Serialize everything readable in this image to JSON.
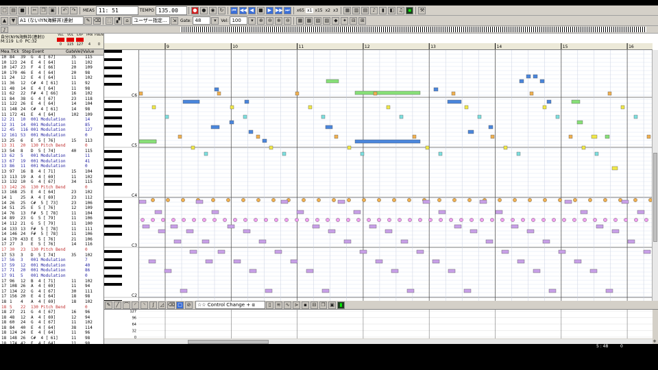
{
  "toolbar": {
    "meas_label": "MEAS",
    "position": "11:  51",
    "tempo_label": "TEMPO",
    "tempo": "135.00",
    "quant_buttons": [
      "x65",
      "x1",
      "x15",
      "x2",
      "x3"
    ],
    "track_select": "A1 (ないIYN海鮮丼)連射",
    "display_mode": "ユーザー指定...",
    "gate_label": "Gate:",
    "gate_value": "48",
    "vel_label": "Vel:",
    "vel_value": "100"
  },
  "track_info": {
    "name": "自分(NYN海鮮丼(連射))",
    "m_label": "M:",
    "m_value": "119",
    "l_label": "L:",
    "l_value": "0",
    "pc_label": "PC:",
    "pc_value": "32",
    "params": [
      "VEL",
      "VOL",
      "EXP",
      "PAN",
      "P.BEND",
      "MOD",
      "HOLD",
      "CUT",
      "RESO",
      "REV",
      "CHO",
      "DLY"
    ],
    "values": [
      "0",
      "115",
      "127",
      "4",
      "0",
      "0",
      "0",
      "0",
      "40",
      "0",
      "0",
      "0"
    ]
  },
  "event_header": {
    "mea": "Mea.",
    "tick": "Tick",
    "step": "Step",
    "event": "Event",
    "gate": "Gate",
    "vel": "Vel/Value"
  },
  "events": [
    [
      "10",
      "84",
      "39",
      "G  4 [ 67]",
      "35",
      "115"
    ],
    [
      "10",
      "123",
      "24",
      "E  4 [ 64]",
      "11",
      "102"
    ],
    [
      "10",
      "147",
      "23",
      "F  4 [ 66]",
      "20",
      "109"
    ],
    [
      "10",
      "170",
      "46",
      "E  4 [ 64]",
      "20",
      "98"
    ],
    [
      "11",
      "24",
      "12",
      "E  4 [ 64]",
      "11",
      "102"
    ],
    [
      "11",
      "36",
      "12",
      "C#  4 [ 61]",
      "11",
      "92"
    ],
    [
      "11",
      "48",
      "14",
      "E  4 [ 64]",
      "11",
      "98"
    ],
    [
      "11",
      "62",
      "22",
      "F#  4 [ 66]",
      "16",
      "102"
    ],
    [
      "11",
      "84",
      "38",
      "G  4 [ 67]",
      "23",
      "118"
    ],
    [
      "11",
      "122",
      "26",
      "E  4 [ 64]",
      "14",
      "104"
    ],
    [
      "11",
      "148",
      "24",
      "C#  4 [ 61]",
      "14",
      "98"
    ],
    [
      "11",
      "172",
      "41",
      "E  4 [ 64]",
      "102",
      "109"
    ],
    [
      "12",
      "21",
      "10",
      "001 Modulation",
      "",
      "14"
    ],
    [
      "12",
      "31",
      "14",
      "001 Modulation",
      "",
      "85"
    ],
    [
      "12",
      "45",
      "116",
      "001 Modulation",
      "",
      "127"
    ],
    [
      "12",
      "161",
      "53",
      "001 Modulation",
      "",
      "0"
    ],
    [
      "13",
      "25",
      "6",
      "E  5 [ 76]",
      "15",
      "113"
    ],
    [
      "13",
      "31",
      "20",
      "130 Pitch Bend",
      "",
      "0"
    ],
    [
      "13",
      "54",
      "8",
      "D  5 [ 74]",
      "40",
      "115"
    ],
    [
      "13",
      "62",
      "5",
      "001 Modulation",
      "",
      "11"
    ],
    [
      "13",
      "67",
      "19",
      "001 Modulation",
      "",
      "41"
    ],
    [
      "13",
      "86",
      "11",
      "001 Modulation",
      "",
      "0"
    ],
    [
      "13",
      "97",
      "16",
      "B  4 [ 71]",
      "15",
      "104"
    ],
    [
      "13",
      "113",
      "19",
      "A  4 [ 69]",
      "11",
      "102"
    ],
    [
      "13",
      "132",
      "10",
      "G  4 [ 67]",
      "34",
      "115"
    ],
    [
      "13",
      "142",
      "26",
      "130 Pitch Bend",
      "",
      "0"
    ],
    [
      "13",
      "168",
      "25",
      "E  4 [ 64]",
      "23",
      "102"
    ],
    [
      "14",
      "1",
      "25",
      "A  4 [ 69]",
      "23",
      "112"
    ],
    [
      "14",
      "26",
      "25",
      "C#  5 [ 73]",
      "23",
      "106"
    ],
    [
      "14",
      "51",
      "25",
      "E  5 [ 76]",
      "12",
      "109"
    ],
    [
      "14",
      "76",
      "13",
      "F#  5 [ 78]",
      "11",
      "104"
    ],
    [
      "14",
      "89",
      "23",
      "G  5 [ 79]",
      "11",
      "106"
    ],
    [
      "14",
      "112",
      "21",
      "G  5 [ 79]",
      "11",
      "100"
    ],
    [
      "14",
      "133",
      "13",
      "F#  5 [ 78]",
      "11",
      "111"
    ],
    [
      "14",
      "146",
      "24",
      "F#  5 [ 78]",
      "11",
      "106"
    ],
    [
      "14",
      "170",
      "433",
      "E  5 [ 76]",
      "21",
      "106"
    ],
    [
      "17",
      "27",
      "3",
      "E  5 [ 76]",
      "14",
      "116"
    ],
    [
      "17",
      "30",
      "23",
      "130 Pitch Bend",
      "",
      "0"
    ],
    [
      "17",
      "53",
      "3",
      "D  5 [ 74]",
      "35",
      "102"
    ],
    [
      "17",
      "56",
      "3",
      "001 Modulation",
      "",
      "7"
    ],
    [
      "17",
      "59",
      "12",
      "001 Modulation",
      "",
      "40"
    ],
    [
      "17",
      "71",
      "20",
      "001 Modulation",
      "",
      "86"
    ],
    [
      "17",
      "91",
      "5",
      "001 Modulation",
      "",
      "0"
    ],
    [
      "17",
      "96",
      "12",
      "B  4 [ 71]",
      "11",
      "102"
    ],
    [
      "17",
      "108",
      "26",
      "A  4 [ 69]",
      "11",
      "94"
    ],
    [
      "17",
      "134",
      "22",
      "G  4 [ 67]",
      "30",
      "111"
    ],
    [
      "17",
      "156",
      "20",
      "E  4 [ 64]",
      "18",
      "98"
    ],
    [
      "18",
      "1",
      "4",
      "A  4 [ 69]",
      "18",
      "102"
    ],
    [
      "18",
      "5",
      "22",
      "130 Pitch Bend",
      "",
      "0"
    ],
    [
      "18",
      "27",
      "21",
      "G  4 [ 67]",
      "16",
      "96"
    ],
    [
      "18",
      "48",
      "12",
      "A  4 [ 69]",
      "12",
      "94"
    ],
    [
      "18",
      "60",
      "24",
      "G  4 [ 67]",
      "11",
      "102"
    ],
    [
      "18",
      "84",
      "40",
      "E  4 [ 64]",
      "38",
      "114"
    ],
    [
      "18",
      "124",
      "24",
      "E  4 [ 64]",
      "11",
      "96"
    ],
    [
      "18",
      "148",
      "26",
      "C#  4 [ 61]",
      "11",
      "98"
    ],
    [
      "18",
      "174",
      "42",
      "E  4 [ 64]",
      "11",
      "98"
    ],
    [
      "19",
      "24",
      "26",
      "F#  4 [ 66]",
      "11",
      "94"
    ],
    [
      "19",
      "50",
      "25",
      "E  5 [ 76]",
      "11",
      "104"
    ]
  ],
  "ruler": {
    "measures": [
      "9",
      "10",
      "11",
      "12",
      "13",
      "14",
      "15",
      "16"
    ]
  },
  "keyboard": {
    "octaves": [
      "C6",
      "C5",
      "C4",
      "C3",
      "C2"
    ]
  },
  "control": {
    "selector": "☆☆ Control Change + α ☆☆",
    "scale": [
      "127",
      "96",
      "64",
      "32",
      "0"
    ]
  },
  "status": {
    "left": "",
    "pos": "5 : 48",
    "val": "0"
  },
  "colors": {
    "green": "#88e078",
    "blue": "#4a86dc",
    "orange": "#f0b050",
    "yellow": "#f0e848",
    "cyan": "#7de0e0",
    "purple": "#c8a0e8",
    "pink": "#f0a0f0",
    "accent": "#316ac5"
  }
}
